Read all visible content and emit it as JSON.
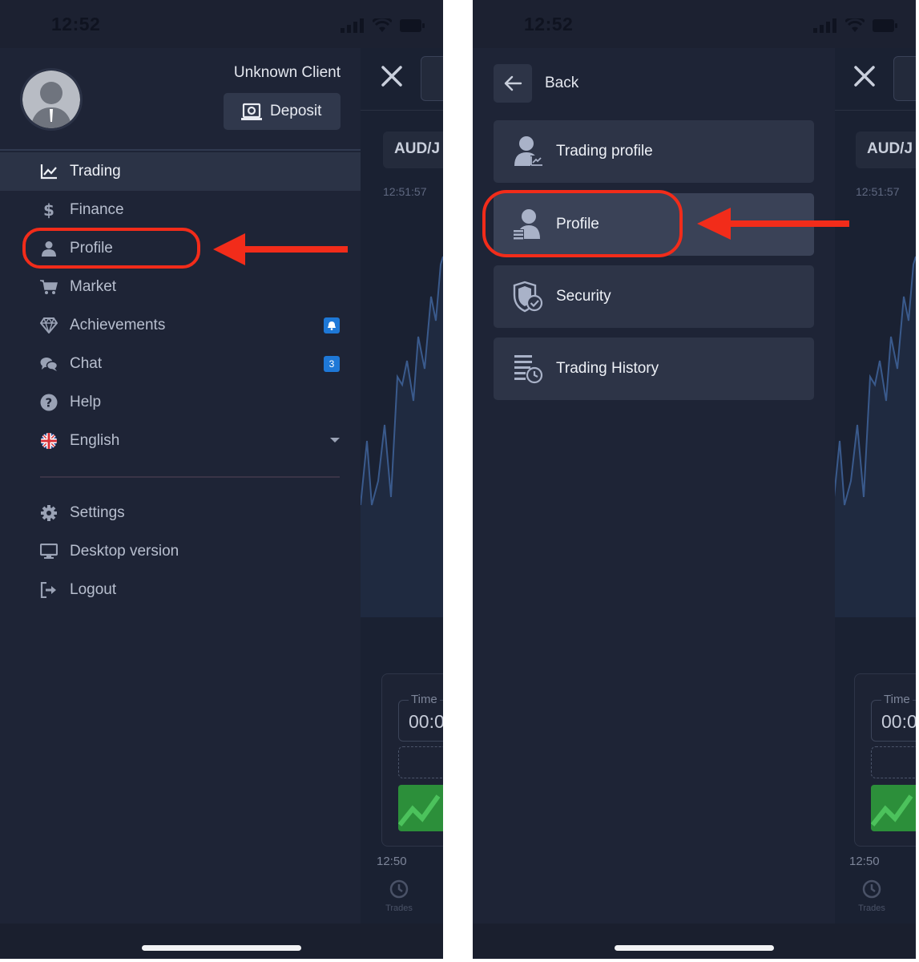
{
  "status_bar": {
    "time": "12:52"
  },
  "left_screen": {
    "account": {
      "client_name": "Unknown Client",
      "deposit_label": "Deposit"
    },
    "menu": [
      {
        "label": "Trading",
        "icon": "chart-line-icon",
        "active": true
      },
      {
        "label": "Finance",
        "icon": "dollar-icon"
      },
      {
        "label": "Profile",
        "icon": "user-icon"
      },
      {
        "label": "Market",
        "icon": "cart-icon"
      },
      {
        "label": "Achievements",
        "icon": "diamond-icon",
        "badge_icon": "bell-icon"
      },
      {
        "label": "Chat",
        "icon": "chat-icon",
        "badge": "3"
      },
      {
        "label": "Help",
        "icon": "question-icon"
      },
      {
        "label": "English",
        "icon": "uk-flag-icon",
        "dropdown": true
      }
    ],
    "secondary_menu": [
      {
        "label": "Settings",
        "icon": "gear-icon"
      },
      {
        "label": "Desktop version",
        "icon": "monitor-icon"
      },
      {
        "label": "Logout",
        "icon": "logout-icon"
      }
    ]
  },
  "right_screen": {
    "back_label": "Back",
    "items": [
      {
        "label": "Trading profile",
        "icon": "trading-profile-icon"
      },
      {
        "label": "Profile",
        "icon": "profile-card-icon",
        "selected": true
      },
      {
        "label": "Security",
        "icon": "shield-check-icon"
      },
      {
        "label": "Trading History",
        "icon": "history-list-icon"
      }
    ]
  },
  "background_app": {
    "asset": "AUD/J",
    "clock": "12:51:57",
    "time_field_label": "Time",
    "time_field_value": "00:0",
    "axis_time": "12:50",
    "trades_label": "Trades"
  },
  "colors": {
    "highlight": "#f22c1a",
    "badge": "#1e78d7",
    "drawer_bg": "#1e2436"
  }
}
